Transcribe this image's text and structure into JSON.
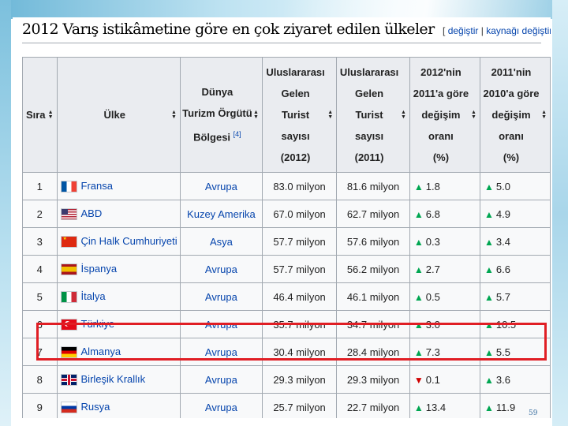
{
  "heading": {
    "title": "2012 Varış istikâmetine göre en çok ziyaret edilen ülkeler",
    "edit_open": "[",
    "edit_link": "değiştir",
    "edit_sep": "|",
    "source_link": "kaynağı değiştir",
    "edit_close": "]"
  },
  "table": {
    "headers": {
      "rank": "Sıra",
      "country": "Ülke",
      "region_lines": [
        "Dünya",
        "Turizm Örgütü",
        "Bölgesi"
      ],
      "region_ref": "[4]",
      "arr2012_lines": [
        "Uluslararası",
        "Gelen",
        "Turist",
        "sayısı",
        "(2012)"
      ],
      "arr2011_lines": [
        "Uluslararası",
        "Gelen",
        "Turist",
        "sayısı",
        "(2011)"
      ],
      "chg12_lines": [
        "2012'nin",
        "2011'a göre",
        "değişim",
        "oranı",
        "(%)"
      ],
      "chg11_lines": [
        "2011'nin",
        "2010'a göre",
        "değişim",
        "oranı",
        "(%)"
      ]
    },
    "rows": [
      {
        "rank": "1",
        "flag": "france-flag",
        "country": "Fransa",
        "region": "Avrupa",
        "arr2012": "83.0 milyon",
        "arr2011": "81.6 milyon",
        "chg12_dir": "up",
        "chg12": "1.8",
        "chg11_dir": "up",
        "chg11": "5.0"
      },
      {
        "rank": "2",
        "flag": "usa-flag",
        "country": "ABD",
        "region": "Kuzey Amerika",
        "arr2012": "67.0 milyon",
        "arr2011": "62.7 milyon",
        "chg12_dir": "up",
        "chg12": "6.8",
        "chg11_dir": "up",
        "chg11": "4.9"
      },
      {
        "rank": "3",
        "flag": "china-flag",
        "country": "Çin Halk Cumhuriyeti",
        "region": "Asya",
        "arr2012": "57.7 milyon",
        "arr2011": "57.6 milyon",
        "chg12_dir": "up",
        "chg12": "0.3",
        "chg11_dir": "up",
        "chg11": "3.4"
      },
      {
        "rank": "4",
        "flag": "spain-flag",
        "country": "İspanya",
        "region": "Avrupa",
        "arr2012": "57.7 milyon",
        "arr2011": "56.2 milyon",
        "chg12_dir": "up",
        "chg12": "2.7",
        "chg11_dir": "up",
        "chg11": "6.6"
      },
      {
        "rank": "5",
        "flag": "italy-flag",
        "country": "İtalya",
        "region": "Avrupa",
        "arr2012": "46.4 milyon",
        "arr2011": "46.1 milyon",
        "chg12_dir": "up",
        "chg12": "0.5",
        "chg11_dir": "up",
        "chg11": "5.7"
      },
      {
        "rank": "6",
        "flag": "turkey-flag",
        "country": "Türkiye",
        "region": "Avrupa",
        "arr2012": "35.7 milyon",
        "arr2011": "34.7 milyon",
        "chg12_dir": "up",
        "chg12": "3.0",
        "chg11_dir": "up",
        "chg11": "10.5"
      },
      {
        "rank": "7",
        "flag": "germany-flag",
        "country": "Almanya",
        "region": "Avrupa",
        "arr2012": "30.4 milyon",
        "arr2011": "28.4 milyon",
        "chg12_dir": "up",
        "chg12": "7.3",
        "chg11_dir": "up",
        "chg11": "5.5"
      },
      {
        "rank": "8",
        "flag": "uk-flag",
        "country": "Birleşik Krallık",
        "region": "Avrupa",
        "arr2012": "29.3 milyon",
        "arr2011": "29.3 milyon",
        "chg12_dir": "down",
        "chg12": "0.1",
        "chg11_dir": "up",
        "chg11": "3.6"
      },
      {
        "rank": "9",
        "flag": "russia-flag",
        "country": "Rusya",
        "region": "Avrupa",
        "arr2012": "25.7 milyon",
        "arr2011": "22.7 milyon",
        "chg12_dir": "up",
        "chg12": "13.4",
        "chg11_dir": "up",
        "chg11": "11.9"
      }
    ]
  },
  "highlighted_row": "Türkiye",
  "page_number": "59",
  "colors": {
    "link": "#0645ad",
    "header_bg": "#eaecf0",
    "cell_bg": "#f8f9fa",
    "up_arrow": "#00a651",
    "down_arrow": "#d00000",
    "highlight_box": "#e01e24"
  }
}
